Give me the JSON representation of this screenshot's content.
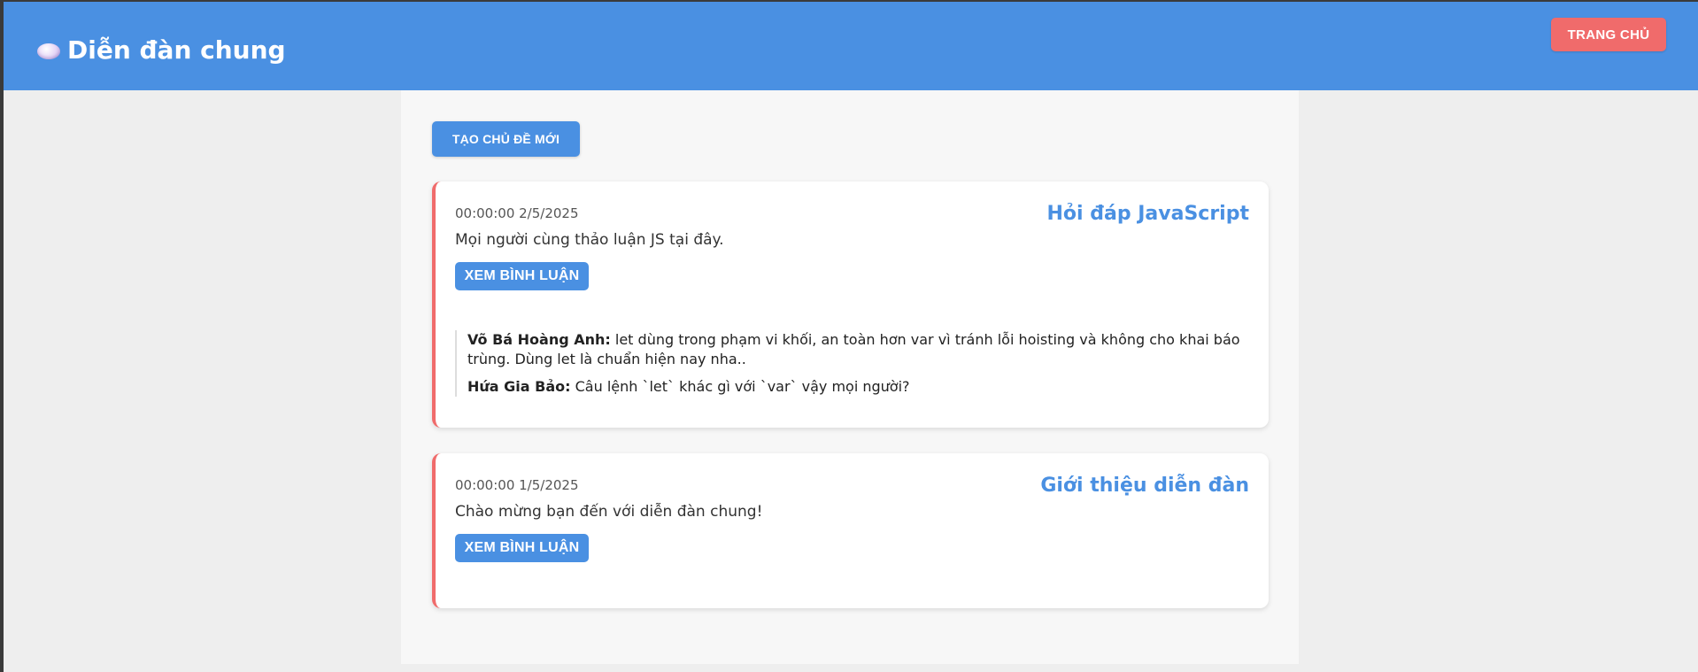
{
  "header": {
    "title": "Diễn đàn chung",
    "icon": "thought-bubble-icon",
    "home_button": "TRANG CHỦ"
  },
  "main": {
    "new_topic_button": "TẠO CHỦ ĐỀ MỚI",
    "topics": [
      {
        "date": "00:00:00 2/5/2025",
        "title": "Hỏi đáp JavaScript",
        "description": "Mọi người cùng thảo luận JS tại đây.",
        "view_comments_label": "XEM BÌNH LUẬN",
        "comments": [
          {
            "author": "Võ Bá Hoàng Anh:",
            "text": "let dùng trong phạm vi khối, an toàn hơn var vì tránh lỗi hoisting và không cho khai báo trùng. Dùng let là chuẩn hiện nay nha.."
          },
          {
            "author": "Hứa Gia Bảo:",
            "text": "Câu lệnh `let` khác gì với `var` vậy mọi người?"
          }
        ]
      },
      {
        "date": "00:00:00 1/5/2025",
        "title": "Giới thiệu diễn đàn",
        "description": "Chào mừng bạn đến với diễn đàn chung!",
        "view_comments_label": "XEM BÌNH LUẬN",
        "comments": []
      }
    ]
  },
  "colors": {
    "header_bg": "#4a90e2",
    "primary": "#4a90e2",
    "accent_red": "#f06b6b",
    "page_bg": "#eeeeee",
    "content_bg": "#f7f7f7"
  }
}
